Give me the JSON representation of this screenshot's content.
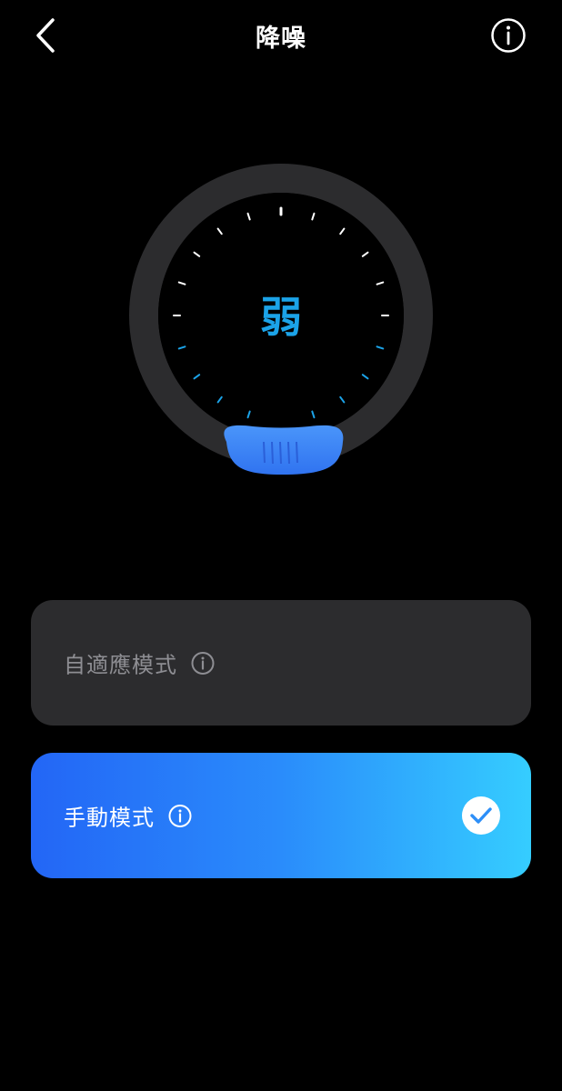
{
  "header": {
    "title": "降噪",
    "back_icon": "chevron-left-icon",
    "info_icon": "info-circle-icon"
  },
  "dial": {
    "level_label": "弱",
    "active_color": "#1ba3e8",
    "inactive_color": "#ffffff",
    "handle_color": "#3d8bf8",
    "ring_color": "#2c2c2e"
  },
  "modes": [
    {
      "label": "自適應模式",
      "selected": false,
      "info_icon": "info-circle-icon"
    },
    {
      "label": "手動模式",
      "selected": true,
      "info_icon": "info-circle-icon",
      "selected_icon": "checkmark-circle-icon"
    }
  ],
  "colors": {
    "background": "#000000",
    "card_inactive": "#2c2c2e",
    "gradient_start": "#2366f6",
    "gradient_end": "#35cdff"
  }
}
